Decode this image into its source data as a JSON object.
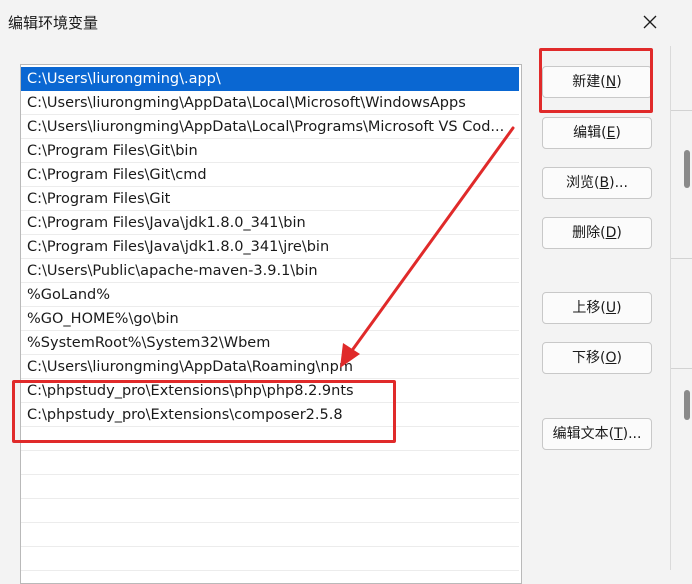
{
  "window": {
    "title": "编辑环境变量"
  },
  "paths": [
    "C:\\Users\\liurongming\\.app\\",
    "C:\\Users\\liurongming\\AppData\\Local\\Microsoft\\WindowsApps",
    "C:\\Users\\liurongming\\AppData\\Local\\Programs\\Microsoft VS Cod...",
    "C:\\Program Files\\Git\\bin",
    "C:\\Program Files\\Git\\cmd",
    "C:\\Program Files\\Git",
    "C:\\Program Files\\Java\\jdk1.8.0_341\\bin",
    "C:\\Program Files\\Java\\jdk1.8.0_341\\jre\\bin",
    "C:\\Users\\Public\\apache-maven-3.9.1\\bin",
    "%GoLand%",
    "%GO_HOME%\\go\\bin",
    "%SystemRoot%\\System32\\Wbem",
    "C:\\Users\\liurongming\\AppData\\Roaming\\npm",
    "C:\\phpstudy_pro\\Extensions\\php\\php8.2.9nts",
    "C:\\phpstudy_pro\\Extensions\\composer2.5.8"
  ],
  "selected_index": 0,
  "buttons": {
    "new": {
      "label": "新建(",
      "key": "N",
      "tail": ")"
    },
    "edit": {
      "label": "编辑(",
      "key": "E",
      "tail": ")"
    },
    "browse": {
      "label": "浏览(",
      "key": "B",
      "tail": ")..."
    },
    "delete": {
      "label": "删除(",
      "key": "D",
      "tail": ")"
    },
    "move_up": {
      "label": "上移(",
      "key": "U",
      "tail": ")"
    },
    "move_down": {
      "label": "下移(",
      "key": "O",
      "tail": ")"
    },
    "edit_text": {
      "label": "编辑文本(",
      "key": "T",
      "tail": ")..."
    }
  },
  "colors": {
    "selection": "#0a67d2",
    "annotation": "#e02a2a"
  }
}
